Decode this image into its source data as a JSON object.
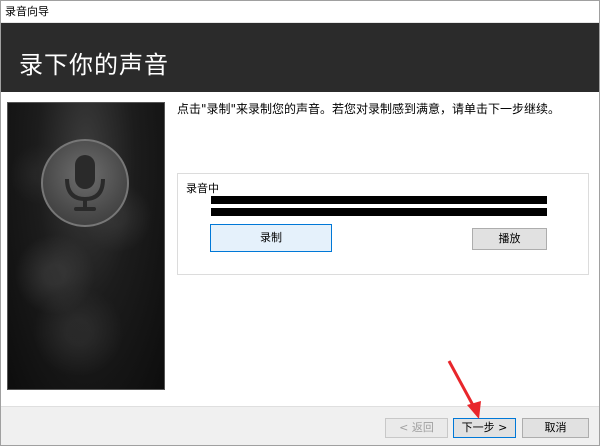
{
  "window": {
    "title": "录音向导"
  },
  "banner": {
    "title": "录下你的声音"
  },
  "instruction": {
    "text": "点击\"录制\"来录制您的声音。若您对录制感到满意，请单击下一步继续。"
  },
  "group": {
    "label": "录音中",
    "record_label": "录制",
    "play_label": "播放"
  },
  "footer": {
    "back_label": "< 返回",
    "next_label": "下一步 >",
    "cancel_label": "取消"
  },
  "colors": {
    "accent": "#0078d7",
    "annotation_arrow": "#e8262b",
    "banner_bg": "#2b2b2b"
  }
}
